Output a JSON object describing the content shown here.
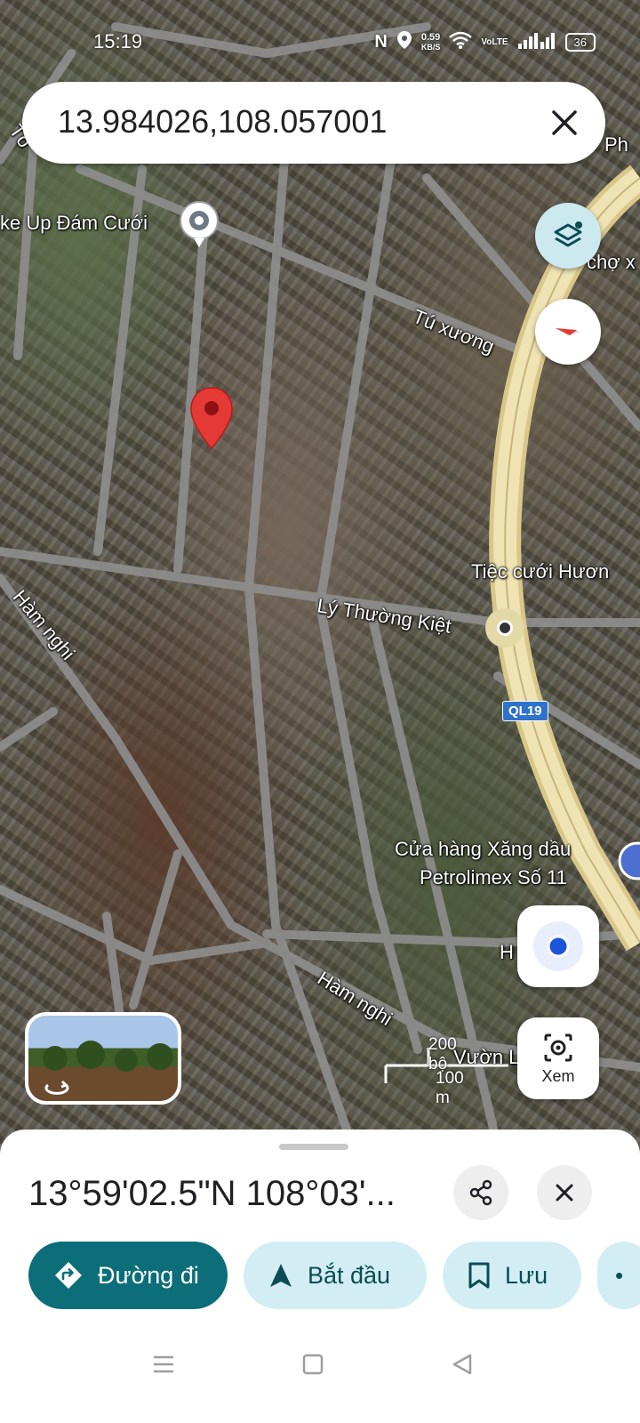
{
  "status": {
    "time": "15:19",
    "speed_value": "0.59",
    "speed_unit": "KB/S",
    "battery": "36",
    "network": "VoLTE"
  },
  "search": {
    "query": "13.984026,108.057001"
  },
  "map": {
    "labels": {
      "poi_wedding_makeup": "ke Up Đám Cưới",
      "street_tu_xuong": "Tú xương",
      "street_ly_thuong_kiet": "Lý Thường Kiệt",
      "street_ham_nghi_1": "Hàm nghi",
      "street_ham_nghi_2": "Hàm nghi",
      "poi_tiec_cuoi": "Tiệc cưới Hươn",
      "poi_gas_station_1": "Cửa hàng Xăng dầu",
      "poi_gas_station_2": "Petrolimex Số 11",
      "edge_top_left": "Tô",
      "edge_top_right": "Ph",
      "edge_cho": "chợ x",
      "edge_h": "H",
      "edge_bottom_right": "Vườn La"
    },
    "highway_shield": "QL19",
    "scale": {
      "imperial": "200 bộ",
      "metric": "100 m"
    },
    "colors": {
      "pin": "#e53935",
      "highway": "#e9d9a0",
      "road": "#9a9a9a"
    }
  },
  "buttons": {
    "xem_label": "Xem"
  },
  "sheet": {
    "title": "13°59'02.5\"N 108°03'...",
    "actions": {
      "directions": "Đường đi",
      "start": "Bắt đầu",
      "save": "Lưu"
    }
  },
  "icons": [
    "close-icon",
    "layers-icon",
    "compass-icon",
    "my-location-icon",
    "lens-icon",
    "share-icon",
    "directions-icon",
    "navigation-arrow-icon",
    "bookmark-icon",
    "menu-icon",
    "home-square-icon",
    "back-triangle-icon"
  ]
}
